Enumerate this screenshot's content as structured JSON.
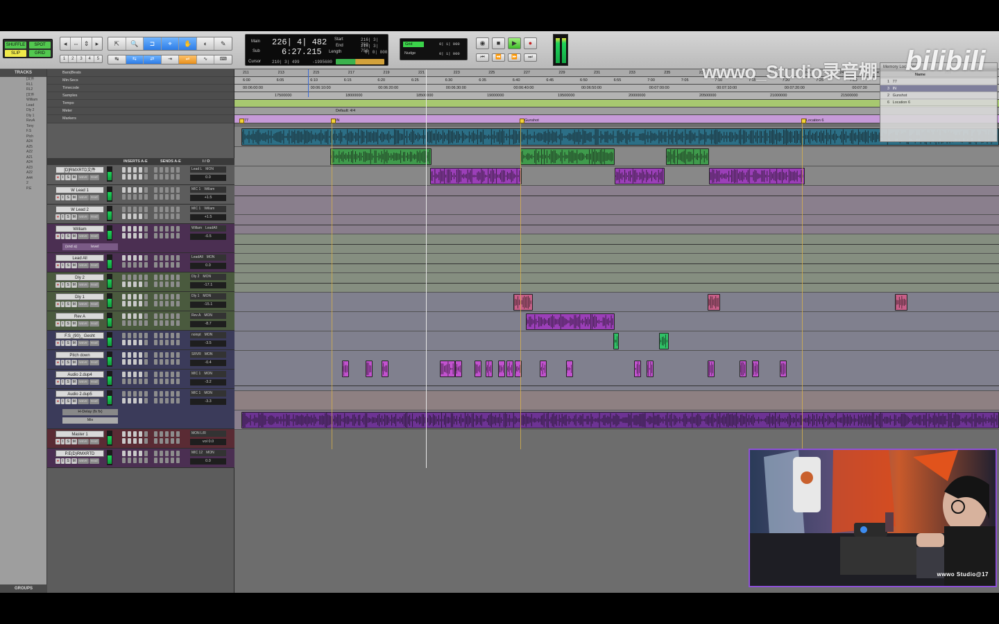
{
  "toolbar": {
    "edit_modes": [
      "SHUFFLE",
      "SPOT",
      "SLIP",
      "GRID"
    ],
    "zoom_presets": [
      "1",
      "2",
      "3",
      "4",
      "5"
    ],
    "counter": {
      "main_label": "Main",
      "sub_label": "Sub",
      "main_value": "226| 4| 482",
      "sub_value": "6:27.215",
      "start_label": "Start",
      "end_label": "End",
      "length_label": "Length",
      "start_value": "216| 3| 750",
      "end_value": "216| 3| 750",
      "length_value": "0| 0| 000",
      "cursor_label": "Cursor",
      "cursor_value": "210| 3| 499",
      "cursor_sample": "-1995680"
    },
    "grid_label": "Grid",
    "grid_value": "0| 1| 000",
    "nudge_label": "Nudge",
    "nudge_value": "0| 1| 000"
  },
  "tracks_panel": {
    "header": "TRACKS",
    "groups_header": "GROUPS",
    "items": [
      "[文件",
      "RL1",
      "RL2",
      "[文件",
      "William",
      "Lead",
      "Dly 2",
      "Dly 1",
      "RevA",
      "Tony",
      "F.S",
      "Ptch",
      "A24",
      "A25",
      "A22",
      "A21",
      "A24",
      "A23",
      "A22",
      "A44",
      "2",
      "P.E"
    ]
  },
  "rulers": {
    "labels": [
      "Bars|Beats",
      "Min:Secs",
      "Timecode",
      "Samples",
      "Tempo",
      "Meter",
      "Markers"
    ],
    "bars": [
      "211",
      "213",
      "215",
      "217",
      "219",
      "221",
      "223",
      "225",
      "227",
      "229",
      "231",
      "233",
      "235",
      "237",
      "239",
      "241",
      "243",
      "245",
      "247",
      "249",
      "251"
    ],
    "minsecs": [
      "6:00",
      "6:05",
      "6:10",
      "6:15",
      "6:20",
      "6:25",
      "6:30",
      "6:35",
      "6:40",
      "6:45",
      "6:50",
      "6:55",
      "7:00",
      "7:05",
      "7:10",
      "7:15",
      "7:20",
      "7:25",
      "7:30"
    ],
    "timecode": [
      "00:06:00:00",
      "00:06:10:00",
      "00:06:20:00",
      "00:06:30:00",
      "00:06:40:00",
      "00:06:50:00",
      "00:07:00:00",
      "00:07:10:00",
      "00:07:20:00",
      "00:07:30"
    ],
    "samples": [
      "17500000",
      "18000000",
      "18500000",
      "19000000",
      "19500000",
      "20000000",
      "20500000",
      "21000000",
      "21500000"
    ],
    "meter_text": "Default: 4/4",
    "markers": [
      "77",
      "IN",
      "Gunshot",
      "Location 6"
    ]
  },
  "columns": {
    "inserts": "INSERTS A-E",
    "sends": "SENDS A-E",
    "io": "I / O"
  },
  "tracks": [
    {
      "name": "[D]RMXRTD文件",
      "io_in": "Lead L",
      "io_mon": "MON",
      "vol": "0.0"
    },
    {
      "name": "W Lead 1",
      "io_in": "MIC 1",
      "io_mon": "Willam",
      "vol": "+1.5"
    },
    {
      "name": "W Lead 2",
      "io_in": "MIC 1",
      "io_mon": "Willam",
      "vol": "+1.5"
    },
    {
      "name": "William",
      "io_in": "Willam",
      "io_mon": "LeadAll",
      "vol": "-0.5",
      "send_label": "(snd a)",
      "send_level": "level"
    },
    {
      "name": "Lead All",
      "io_in": "LeadAll",
      "io_mon": "MON",
      "vol": "0.0"
    },
    {
      "name": "Dly 2",
      "io_in": "Dly 2",
      "io_mon": "MON",
      "vol": "-17.1"
    },
    {
      "name": "Dly 1",
      "io_in": "Dly 1",
      "io_mon": "MON",
      "vol": "-15.1"
    },
    {
      "name": "Rev A",
      "io_in": "Rev A",
      "io_mon": "MON",
      "vol": "-8.7"
    },
    {
      "name": "F.S_(90)_ Gesht",
      "io_in": "noinpt",
      "io_mon": "MON",
      "vol": "-3.5"
    },
    {
      "name": "Pitch down",
      "io_in": "SRVR",
      "io_mon": "MON",
      "vol": "-0.4"
    },
    {
      "name": "Audio 2.dup4",
      "io_in": "MIC 1",
      "io_mon": "MON",
      "vol": "-3.2"
    },
    {
      "name": "Audio 2.dup5",
      "io_in": "MIC 1",
      "io_mon": "MON",
      "vol": "-3.3",
      "plugin": "H-Delay (fx fx)",
      "plugin_param": "Mix"
    },
    {
      "name": "Master 1",
      "io_in": "MON L/R",
      "io_mon": "",
      "vol": "0.0",
      "vol_label": "vol"
    },
    {
      "name": "P.E(D)RMXRTD",
      "io_in": "MIC 12",
      "io_mon": "MON",
      "vol": "0.0"
    }
  ],
  "memory_window": {
    "title": "Memory Locations",
    "name_col": "Name",
    "rows": [
      "77",
      "IN",
      "Gunshot",
      "Location 6"
    ],
    "row_numbers": [
      "1",
      "3",
      "2",
      "6"
    ]
  },
  "watermark": "wwwo_Studio录音棚",
  "bilibili": "bilibili",
  "webcam_caption": "wwwo Studio@17",
  "colors": {
    "blue_clip": "#2c6f86",
    "green_clip": "#3f9b4c",
    "purple_clip": "#9b3fb8",
    "pink_clip": "#c75f88",
    "marker_bg": "#c69ad8",
    "tempo_bg": "#a7c870"
  }
}
